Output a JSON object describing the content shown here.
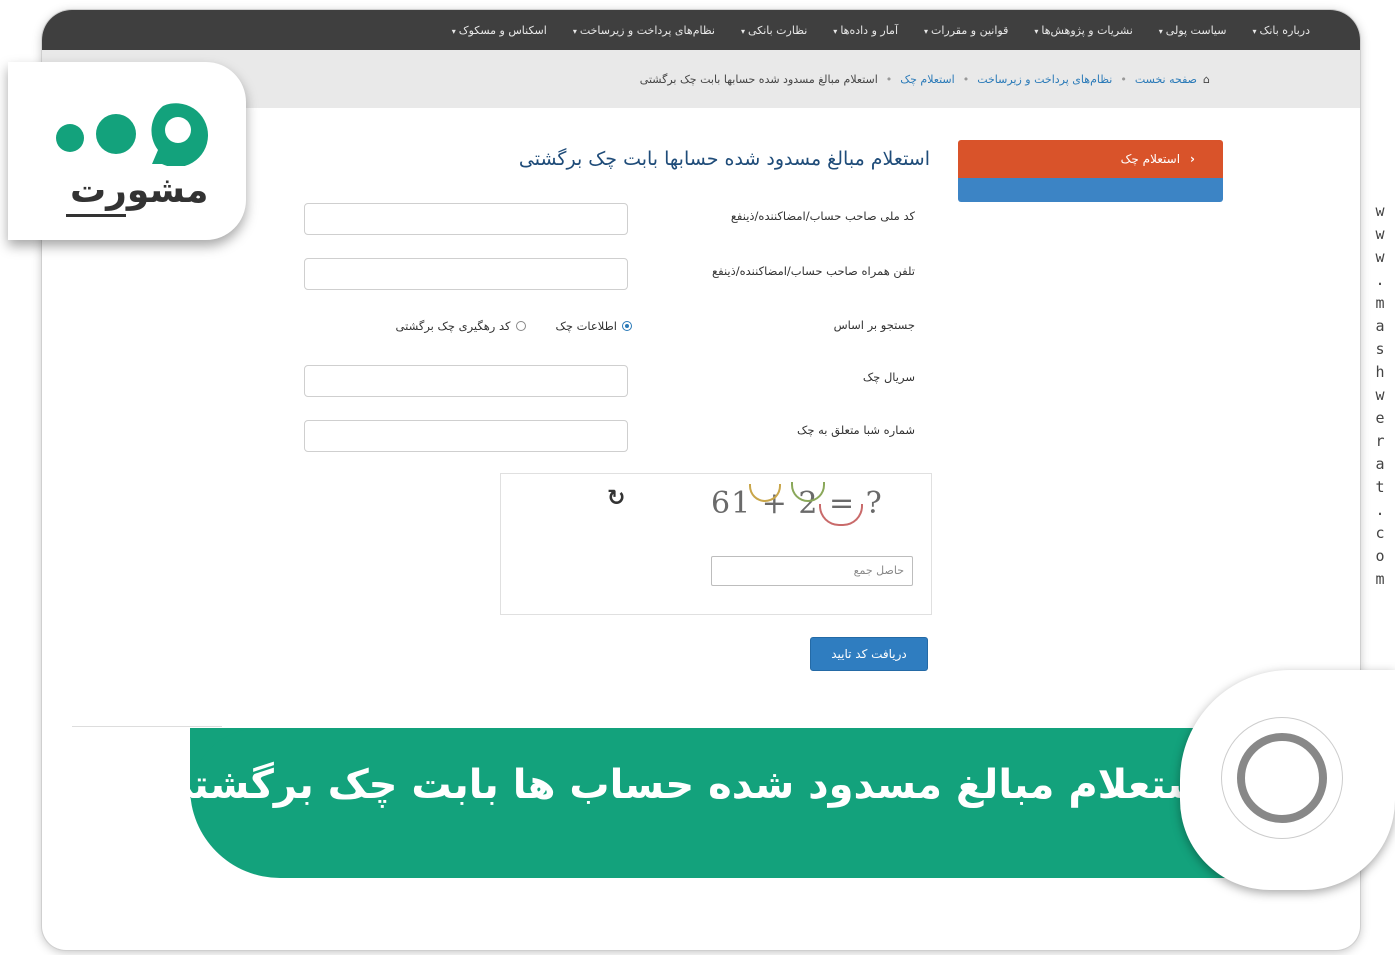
{
  "nav": {
    "items": [
      "درباره بانک",
      "سیاست پولی",
      "نشریات و پژوهش‌ها",
      "قوانین و مقررات",
      "آمار و داده‌ها",
      "نظارت بانکی",
      "نظام‌های پرداخت و زیرساخت",
      "اسکناس و مسکوک"
    ]
  },
  "breadcrumb": {
    "home": "صفحه نخست",
    "level1": "نظام‌های پرداخت و زیرساخت",
    "level2": "استعلام چک",
    "current": "استعلام مبالغ مسدود شده حسابها بابت چک برگشتی"
  },
  "sidebar": {
    "active_label": "استعلام چک",
    "accent": "#d9532a",
    "secondary": "#3c84c5"
  },
  "form": {
    "title": "استعلام مبالغ مسدود شده حسابها بابت چک برگشتی",
    "national_id_label": "کد ملی صاحب حساب/امضاکننده/ذینفع",
    "mobile_label": "تلفن همراه صاحب حساب/امضاکننده/ذینفع",
    "search_by_label": "جستجو بر اساس",
    "radio_check_info": "اطلاعات چک",
    "radio_tracking_code": "کد رهگیری چک برگشتی",
    "serial_label": "سریال چک",
    "sheba_label": "شماره شبا متعلق به چک",
    "captcha_expr": "61 + 2 = ?",
    "captcha_placeholder": "حاصل جمع",
    "submit_label": "دریافت کد تایید"
  },
  "banner": {
    "title": "استعلام مبالغ مسدود شده حساب ها بابت چک برگشتی",
    "color": "#13a27c"
  },
  "brand": {
    "logo_text": "مشورت",
    "watermark": "www.mashwerat.com"
  }
}
